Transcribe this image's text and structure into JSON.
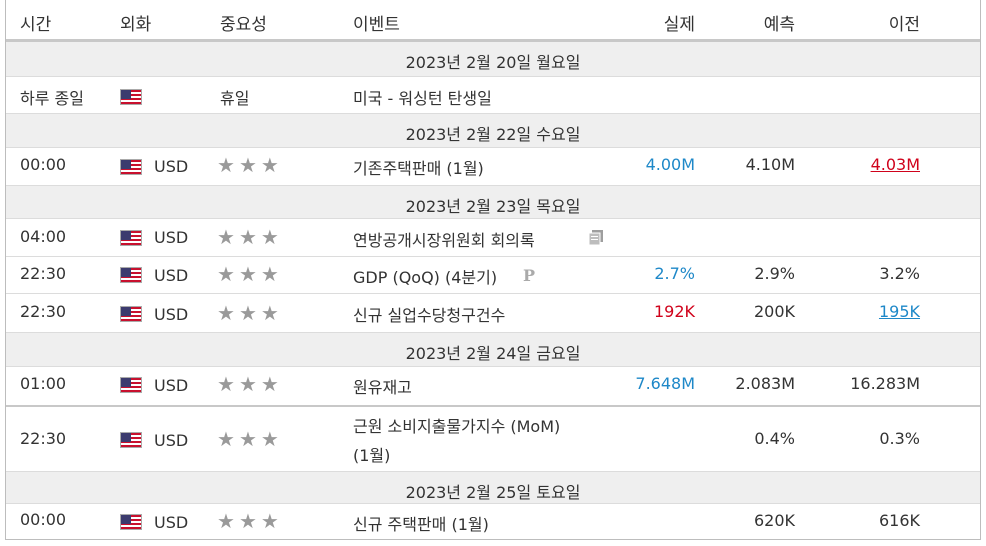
{
  "headers": {
    "time": "시간",
    "currency": "외화",
    "importance": "중요성",
    "event": "이벤트",
    "actual": "실제",
    "forecast": "예측",
    "previous": "이전"
  },
  "dates": [
    "2023년 2월 20일 월요일",
    "2023년 2월 22일 수요일",
    "2023년 2월 23일 목요일",
    "2023년 2월 24일 금요일",
    "2023년 2월 25일 토요일"
  ],
  "rows": [
    {
      "time": "하루 종일",
      "currency": "",
      "importance": "휴일",
      "event": "미국 - 워싱턴 탄생일",
      "actual": "",
      "forecast": "",
      "previous": ""
    },
    {
      "time": "00:00",
      "currency": "USD",
      "importance": "3",
      "event": "기존주택판매 (1월)",
      "actual": "4.00M",
      "forecast": "4.10M",
      "previous": "4.03M"
    },
    {
      "time": "04:00",
      "currency": "USD",
      "importance": "3",
      "event": "연방공개시장위원회 회의록",
      "actual": "",
      "forecast": "",
      "previous": ""
    },
    {
      "time": "22:30",
      "currency": "USD",
      "importance": "3",
      "event": "GDP (QoQ) (4분기)",
      "actual": "2.7%",
      "forecast": "2.9%",
      "previous": "3.2%"
    },
    {
      "time": "22:30",
      "currency": "USD",
      "importance": "3",
      "event": "신규 실업수당청구건수",
      "actual": "192K",
      "forecast": "200K",
      "previous": "195K"
    },
    {
      "time": "01:00",
      "currency": "USD",
      "importance": "3",
      "event": "원유재고",
      "actual": "7.648M",
      "forecast": "2.083M",
      "previous": "16.283M"
    },
    {
      "time": "22:30",
      "currency": "USD",
      "importance": "3",
      "event_line1": "근원 소비지출물가지수 (MoM)",
      "event_line2": "(1월)",
      "actual": "",
      "forecast": "0.4%",
      "previous": "0.3%"
    },
    {
      "time": "00:00",
      "currency": "USD",
      "importance": "3",
      "event": "신규 주택판매 (1월)",
      "actual": "",
      "forecast": "620K",
      "previous": "616K"
    }
  ],
  "colors": {
    "positive": "#1e88c8",
    "negative": "#d0021b",
    "stars": "#9a9a9a",
    "date_bg": "#efefef"
  },
  "icons": {
    "flag": "us-flag-icon",
    "star": "star-icon",
    "document": "document-icon",
    "preliminary": "p-icon"
  }
}
